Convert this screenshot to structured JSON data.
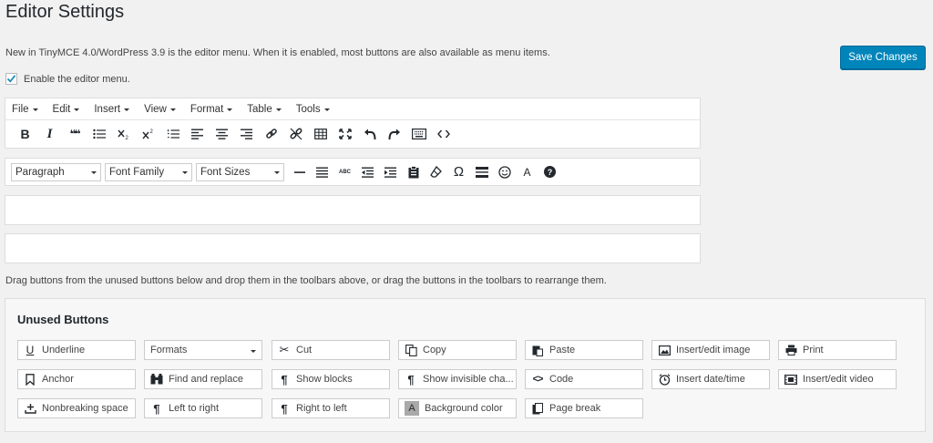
{
  "page": {
    "title": "Editor Settings",
    "intro": "New in TinyMCE 4.0/WordPress 3.9 is the editor menu. When it is enabled, most buttons are also available as menu items.",
    "save_label": "Save Changes",
    "enable_label": "Enable the editor menu.",
    "enable_checked": true,
    "drag_note": "Drag buttons from the unused buttons below and drop them in the toolbars above, or drag the buttons in the toolbars to rearrange them."
  },
  "menubar": [
    "File",
    "Edit",
    "Insert",
    "View",
    "Format",
    "Table",
    "Tools"
  ],
  "toolbar1": {
    "bold": "B",
    "italic": "I",
    "blockquote": "❝❝"
  },
  "toolbar2": {
    "paragraph": "Paragraph",
    "font_family": "Font Family",
    "font_sizes": "Font Sizes",
    "strike_text": "ABC",
    "omega": "Ω",
    "text_color": "A",
    "help": "?"
  },
  "unused": {
    "title": "Unused Buttons",
    "buttons": [
      {
        "label": "Underline",
        "icon": "underline-icon",
        "glyph": "U"
      },
      {
        "label": "Formats",
        "icon": "chevron-down-icon"
      },
      {
        "label": "Cut",
        "icon": "scissors-icon",
        "glyph": "✂"
      },
      {
        "label": "Copy",
        "icon": "copy-icon"
      },
      {
        "label": "Paste",
        "icon": "paste-icon"
      },
      {
        "label": "Insert/edit image",
        "icon": "image-icon"
      },
      {
        "label": "Print",
        "icon": "printer-icon"
      },
      {
        "label": "Anchor",
        "icon": "bookmark-icon"
      },
      {
        "label": "Find and replace",
        "icon": "binoculars-icon"
      },
      {
        "label": "Show blocks",
        "icon": "pilcrow-icon",
        "glyph": "¶"
      },
      {
        "label": "Show invisible cha...",
        "icon": "pilcrow-icon",
        "glyph": "¶"
      },
      {
        "label": "Code",
        "icon": "code-icon",
        "glyph": "<>"
      },
      {
        "label": "Insert date/time",
        "icon": "clock-icon"
      },
      {
        "label": "Insert/edit video",
        "icon": "film-icon"
      },
      {
        "label": "Nonbreaking space",
        "icon": "nbsp-icon"
      },
      {
        "label": "Left to right",
        "icon": "ltr-icon",
        "glyph": "¶"
      },
      {
        "label": "Right to left",
        "icon": "rtl-icon",
        "glyph": "¶"
      },
      {
        "label": "Background color",
        "icon": "background-color-icon",
        "glyph": "A"
      },
      {
        "label": "Page break",
        "icon": "page-break-icon"
      }
    ]
  },
  "colors": {
    "primary": "#0085ba",
    "background": "#f1f1f1",
    "panel": "#ffffff"
  }
}
